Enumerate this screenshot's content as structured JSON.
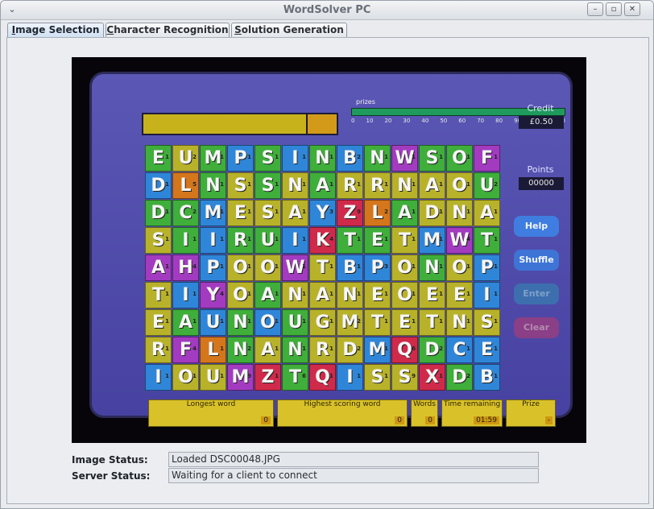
{
  "window": {
    "title": "WordSolver PC",
    "menu_glyph": "⌄",
    "min_glyph": "–",
    "max_glyph": "▫",
    "close_glyph": "✕"
  },
  "tabs": [
    {
      "label": "Image Selection",
      "mnemonic": "I",
      "rest": "mage Selection",
      "active": true
    },
    {
      "label": "Character Recognition",
      "mnemonic": "C",
      "rest": "haracter Recognition",
      "active": false
    },
    {
      "label": "Solution Generation",
      "mnemonic": "S",
      "rest": "olution Generation",
      "active": false
    }
  ],
  "photo": {
    "prizes_label": "prizes",
    "prize_ticks": [
      "0",
      "10",
      "20",
      "30",
      "40",
      "50",
      "60",
      "70",
      "80",
      "90",
      "100",
      "110"
    ],
    "grid": [
      "EUMPSINBNWSOF",
      "DLNSSNARRNAOU",
      "DCMESAYZLADNA",
      "SIIRUIKTETMWT",
      "AHPOOWTBPONOP",
      "TIYOANANEOEEI",
      "EAUNOUGMTETNS",
      "RFLNANRDMQDCE",
      "IOUMZTQISSXDB"
    ],
    "colors": [
      "gygbgbgbgpggp",
      "bogygygyyyyyg",
      "ggbyyybrogyyy",
      "ygbggbrggybpg",
      "ppbyypybbygyb",
      "ybpygyyyyyyyb",
      "ygbgbgyyyyyyy",
      "ypogygyybrgbb",
      "byyprgrbyyrgb"
    ],
    "points": [
      "1211111211111",
      "1511111111112",
      "1211113921111",
      "1111114111141",
      "1411111131111",
      "1141111111111",
      "1111111211111",
      "1412111216211",
      "1119161119121"
    ],
    "credit_label": "Credit",
    "credit_value": "£0.50",
    "points_label": "Points",
    "points_value": "00000",
    "side_buttons": [
      "Help",
      "Shuffle",
      "Enter",
      "Clear"
    ],
    "bottom": {
      "longest_label": "Longest word",
      "longest_value": "0",
      "highest_label": "Highest scoring word",
      "highest_value": "0",
      "words_label": "Words",
      "words_value": "0",
      "time_label": "Time remaining",
      "time_value": "01:59",
      "prize_label": "Prize",
      "prize_value": "-"
    }
  },
  "status": {
    "image_label": "Image Status:",
    "image_value": "Loaded DSC00048.JPG",
    "server_label": "Server Status:",
    "server_value": "Waiting for a client to connect"
  }
}
